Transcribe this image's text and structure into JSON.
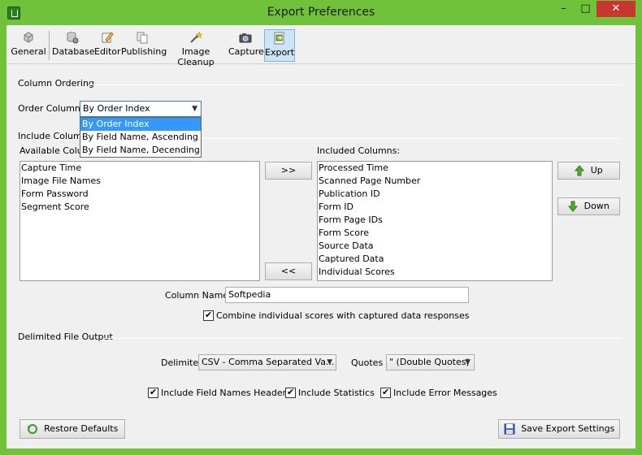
{
  "window": {
    "title": "Export Preferences",
    "minimize": "–",
    "maximize": "□",
    "close": "✕"
  },
  "toolbar": {
    "items": [
      {
        "label": "General",
        "icon": "general-icon"
      },
      {
        "label": "Database",
        "icon": "database-icon"
      },
      {
        "label": "Editor",
        "icon": "editor-icon"
      },
      {
        "label": "Publishing",
        "icon": "publishing-icon"
      },
      {
        "label": "Image Cleanup",
        "icon": "image-cleanup-icon"
      },
      {
        "label": "Capture",
        "icon": "capture-icon"
      },
      {
        "label": "Export",
        "icon": "export-icon"
      }
    ],
    "active": "Export"
  },
  "column_ordering": {
    "group_label": "Column Ordering",
    "order_label": "Order Columns",
    "selected": "By Order Index",
    "options": [
      "By Order Index",
      "By Field Name, Ascending",
      "By Field Name, Decending"
    ]
  },
  "include_columns": {
    "group_label": "Include Columns",
    "available_label": "Available Columns:",
    "available": [
      "Capture Time",
      "Image File Names",
      "Form Password",
      "Segment Score"
    ],
    "included_label": "Included Columns:",
    "included": [
      "Processed Time",
      "Scanned Page Number",
      "Publication ID",
      "Form ID",
      "Form Page IDs",
      "Form Score",
      "Source Data",
      "Captured Data",
      "Individual Scores"
    ],
    "add_button": ">>",
    "remove_button": "<<",
    "up_button": "Up",
    "down_button": "Down",
    "column_name_label": "Column Name:",
    "column_name_value": "Softpedia",
    "combine_label": "Combine individual scores with captured data responses"
  },
  "delimited": {
    "group_label": "Delimited File Output",
    "delimiter_label": "Delimiter",
    "delimiter_value": "CSV - Comma Separated Va...",
    "quotes_label": "Quotes",
    "quotes_value": "\" (Double Quotes)",
    "field_names_label": "Include Field Names Header",
    "statistics_label": "Include Statistics",
    "error_messages_label": "Include Error Messages"
  },
  "footer": {
    "restore_label": "Restore Defaults",
    "save_label": "Save Export Settings"
  },
  "colors": {
    "title_bar": "#6fc23a",
    "close": "#c7372f",
    "selection": "#3399ff"
  }
}
